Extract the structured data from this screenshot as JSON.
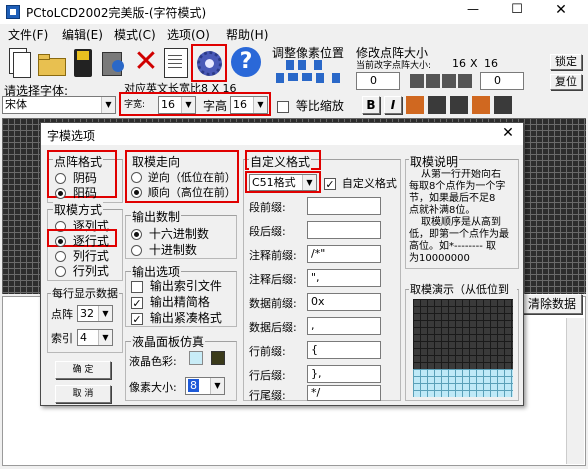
{
  "titlebar": {
    "title": "PCtoLCD2002完美版-(字符模式)",
    "minimize": "—",
    "maximize": "☐",
    "close": "✕"
  },
  "menu": [
    "文件(F)",
    "编辑(E)",
    "模式(C)",
    "选项(O)",
    "帮助(H)"
  ],
  "toolbar": {
    "adjust_pixel_label": "调整像素位置",
    "resize_label": "修改点阵大小",
    "current_size_label": "当前改字点阵大小:",
    "current_w": "16",
    "current_x": "X",
    "current_h": "16",
    "lock_button": "锁定",
    "reset_button": "复位",
    "spin1": "0",
    "spin2": "0"
  },
  "font_row": {
    "select_font_label": "请选择字体:",
    "font_value": "宋体",
    "ascii_label": "对应英文长宽比8 X 16",
    "width_label": "字宽:",
    "width_value": "16",
    "height_label": "字高",
    "height_value": "16",
    "proportional_label": "等比缩放",
    "bold": "B",
    "italic": "I"
  },
  "dialog": {
    "title": "字模选项",
    "close": "✕",
    "dot_format": {
      "title": "点阵格式",
      "options": [
        "阴码",
        "阳码"
      ],
      "selected": 1
    },
    "take_mode": {
      "title": "取模方式",
      "options": [
        "逐列式",
        "逐行式",
        "列行式",
        "行列式"
      ],
      "selected": 1
    },
    "per_line": {
      "title": "每行显示数据",
      "dots_label": "点阵",
      "dots_value": "32",
      "index_label": "索引",
      "index_value": "4"
    },
    "ok_button": "确 定",
    "cancel_button": "取 消",
    "direction": {
      "title": "取模走向",
      "options": [
        "逆向（低位在前）",
        "顺向（高位在前）"
      ],
      "selected": 1
    },
    "output_base": {
      "title": "输出数制",
      "options": [
        "十六进制数",
        "十进制数"
      ],
      "selected": 0
    },
    "output_opts": {
      "title": "输出选项",
      "options": [
        "输出索引文件",
        "输出精简格",
        "输出紧凑格式"
      ],
      "checked": [
        false,
        true,
        true
      ]
    },
    "lcd": {
      "title": "液晶面板仿真",
      "color_label": "液晶色彩:",
      "pixel_label": "像素大小:",
      "pixel_value": "8"
    },
    "custom": {
      "title": "自定义格式",
      "format_value": "C51格式",
      "custom_check_label": "自定义格式",
      "fields": [
        {
          "label": "段前缀:",
          "value": ""
        },
        {
          "label": "段后缀:",
          "value": ""
        },
        {
          "label": "注释前缀:",
          "value": "/*\""
        },
        {
          "label": "注释后缀:",
          "value": "\","
        },
        {
          "label": "数据前缀:",
          "value": "0x"
        },
        {
          "label": "数据后缀:",
          "value": ","
        },
        {
          "label": "行前缀:",
          "value": "{"
        },
        {
          "label": "行后缀:",
          "value": "},"
        },
        {
          "label": "行尾缀:",
          "value": "*/"
        }
      ]
    },
    "desc": {
      "title": "取模说明",
      "lines": [
        "从第一行开始向右",
        "每取8个点作为一个字",
        "节，如果最后不足8",
        "点就补满8位。",
        "取模顺序是从高到",
        "低，即第一个点作为最",
        "高位。如*-------- 取",
        "为10000000"
      ]
    },
    "demo": {
      "title": "取模演示（从低位到"
    }
  },
  "clear_button": "清除数据",
  "colors": {
    "accent_red": "#e00000",
    "lcd_light": "#c8ecf7",
    "lcd_dark": "#3a3a3a"
  }
}
